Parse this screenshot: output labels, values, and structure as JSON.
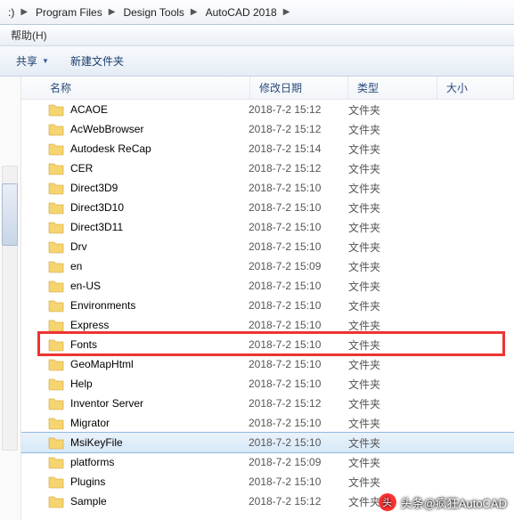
{
  "breadcrumb": {
    "root": ":)",
    "items": [
      "Program Files",
      "Design Tools",
      "AutoCAD 2018"
    ]
  },
  "menubar": {
    "help": "帮助(H)"
  },
  "toolbar": {
    "share": "共享",
    "newfolder": "新建文件夹"
  },
  "columns": {
    "name": "名称",
    "date": "修改日期",
    "type": "类型",
    "size": "大小"
  },
  "type_folder": "文件夹",
  "rows": [
    {
      "name": "ACAOE",
      "date": "2018-7-2 15:12"
    },
    {
      "name": "AcWebBrowser",
      "date": "2018-7-2 15:12"
    },
    {
      "name": "Autodesk ReCap",
      "date": "2018-7-2 15:14"
    },
    {
      "name": "CER",
      "date": "2018-7-2 15:12"
    },
    {
      "name": "Direct3D9",
      "date": "2018-7-2 15:10"
    },
    {
      "name": "Direct3D10",
      "date": "2018-7-2 15:10"
    },
    {
      "name": "Direct3D11",
      "date": "2018-7-2 15:10"
    },
    {
      "name": "Drv",
      "date": "2018-7-2 15:10"
    },
    {
      "name": "en",
      "date": "2018-7-2 15:09"
    },
    {
      "name": "en-US",
      "date": "2018-7-2 15:10"
    },
    {
      "name": "Environments",
      "date": "2018-7-2 15:10"
    },
    {
      "name": "Express",
      "date": "2018-7-2 15:10"
    },
    {
      "name": "Fonts",
      "date": "2018-7-2 15:10",
      "highlight": true
    },
    {
      "name": "GeoMapHtml",
      "date": "2018-7-2 15:10"
    },
    {
      "name": "Help",
      "date": "2018-7-2 15:10"
    },
    {
      "name": "Inventor Server",
      "date": "2018-7-2 15:12"
    },
    {
      "name": "Migrator",
      "date": "2018-7-2 15:10"
    },
    {
      "name": "MsiKeyFile",
      "date": "2018-7-2 15:10",
      "selected": true
    },
    {
      "name": "platforms",
      "date": "2018-7-2 15:09"
    },
    {
      "name": "Plugins",
      "date": "2018-7-2 15:10"
    },
    {
      "name": "Sample",
      "date": "2018-7-2 15:12"
    }
  ],
  "watermark": {
    "text": "头条@疯狂AutoCAD"
  }
}
